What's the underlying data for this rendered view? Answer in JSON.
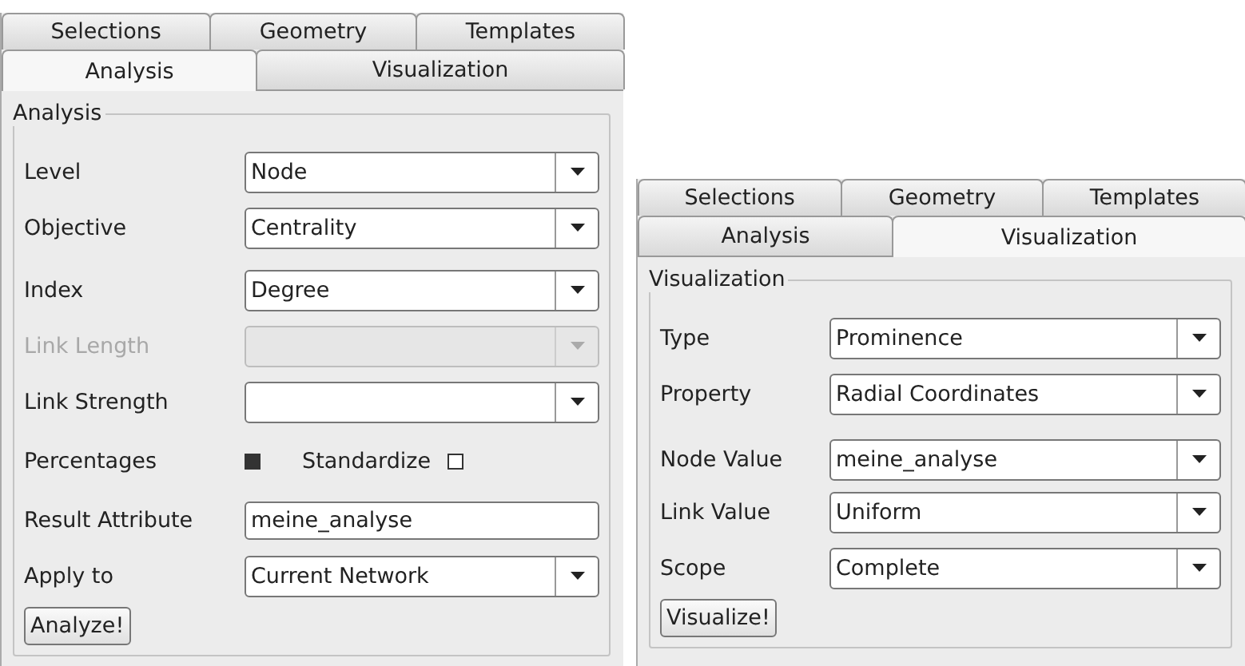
{
  "panels": [
    {
      "tab_rows": [
        [
          {
            "label": "Selections",
            "selected": false
          },
          {
            "label": "Geometry",
            "selected": false
          },
          {
            "label": "Templates",
            "selected": false
          }
        ],
        [
          {
            "label": "Analysis",
            "selected": true
          },
          {
            "label": "Visualization",
            "selected": false
          }
        ]
      ],
      "group_title": "Analysis",
      "rows": [
        {
          "kind": "combo",
          "label": "Level",
          "value": "Node",
          "disabled": false
        },
        {
          "kind": "combo",
          "label": "Objective",
          "value": "Centrality",
          "disabled": false
        },
        {
          "kind": "combo",
          "label": "Index",
          "value": "Degree",
          "disabled": false
        },
        {
          "kind": "combo",
          "label": "Link Length",
          "disabled": true
        },
        {
          "kind": "combo",
          "label": "Link Strength",
          "disabled": false
        },
        {
          "kind": "checks",
          "items": [
            {
              "label": "Percentages",
              "checked": true
            },
            {
              "label": "Standardize",
              "checked": false
            }
          ]
        },
        {
          "kind": "text",
          "label": "Result Attribute",
          "value": "meine_analyse"
        },
        {
          "kind": "combo",
          "label": "Apply to",
          "value": "Current Network",
          "disabled": false
        }
      ],
      "button": "Analyze!"
    },
    {
      "tab_rows": [
        [
          {
            "label": "Selections",
            "selected": false
          },
          {
            "label": "Geometry",
            "selected": false
          },
          {
            "label": "Templates",
            "selected": false
          }
        ],
        [
          {
            "label": "Analysis",
            "selected": false
          },
          {
            "label": "Visualization",
            "selected": true
          }
        ]
      ],
      "group_title": "Visualization",
      "rows": [
        {
          "kind": "combo",
          "label": "Type",
          "value": "Prominence",
          "disabled": false
        },
        {
          "kind": "combo",
          "label": "Property",
          "value": "Radial Coordinates",
          "disabled": false
        },
        {
          "kind": "combo",
          "label": "Node Value",
          "value": "meine_analyse",
          "disabled": false
        },
        {
          "kind": "combo",
          "label": "Link Value",
          "value": "Uniform",
          "disabled": false
        },
        {
          "kind": "combo",
          "label": "Scope",
          "value": "Complete",
          "disabled": false
        }
      ],
      "button": "Visualize!"
    }
  ]
}
